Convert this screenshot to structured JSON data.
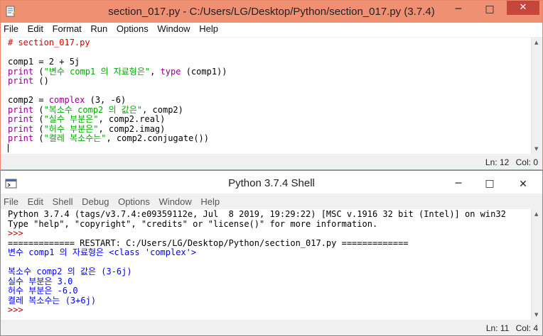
{
  "editor": {
    "title": "section_017.py - C:/Users/LG/Desktop/Python/section_017.py (3.7.4)",
    "menu": [
      "File",
      "Edit",
      "Format",
      "Run",
      "Options",
      "Window",
      "Help"
    ],
    "status": {
      "ln": "Ln: 12",
      "col": "Col: 0"
    },
    "code": [
      [
        [
          "c-comment",
          "# section_017.py"
        ]
      ],
      [],
      [
        [
          "c-normal",
          "comp1 = 2 + 5j"
        ]
      ],
      [
        [
          "c-builtin",
          "print"
        ],
        [
          "c-normal",
          " ("
        ],
        [
          "c-string",
          "\"변수 comp1 의 자료형은\""
        ],
        [
          "c-normal",
          ", "
        ],
        [
          "c-builtin",
          "type"
        ],
        [
          "c-normal",
          " (comp1))"
        ]
      ],
      [
        [
          "c-builtin",
          "print"
        ],
        [
          "c-normal",
          " ()"
        ]
      ],
      [],
      [
        [
          "c-normal",
          "comp2 = "
        ],
        [
          "c-builtin",
          "complex"
        ],
        [
          "c-normal",
          " (3, -6)"
        ]
      ],
      [
        [
          "c-builtin",
          "print"
        ],
        [
          "c-normal",
          " ("
        ],
        [
          "c-string",
          "\"복소수 comp2 의 값은\""
        ],
        [
          "c-normal",
          ", comp2)"
        ]
      ],
      [
        [
          "c-builtin",
          "print"
        ],
        [
          "c-normal",
          " ("
        ],
        [
          "c-string",
          "\"실수 부분은\""
        ],
        [
          "c-normal",
          ", comp2.real)"
        ]
      ],
      [
        [
          "c-builtin",
          "print"
        ],
        [
          "c-normal",
          " ("
        ],
        [
          "c-string",
          "\"허수 부분은\""
        ],
        [
          "c-normal",
          ", comp2.imag)"
        ]
      ],
      [
        [
          "c-builtin",
          "print"
        ],
        [
          "c-normal",
          " ("
        ],
        [
          "c-string",
          "\"켤레 복소수는\""
        ],
        [
          "c-normal",
          ", comp2.conjugate())"
        ]
      ]
    ]
  },
  "shell": {
    "title": "Python 3.7.4 Shell",
    "menu": [
      "File",
      "Edit",
      "Shell",
      "Debug",
      "Options",
      "Window",
      "Help"
    ],
    "status": {
      "ln": "Ln: 11",
      "col": "Col: 4"
    },
    "lines": [
      [
        [
          "c-normal",
          "Python 3.7.4 (tags/v3.7.4:e09359112e, Jul  8 2019, 19:29:22) [MSC v.1916 32 bit (Intel)] on win32"
        ]
      ],
      [
        [
          "c-normal",
          "Type \"help\", \"copyright\", \"credits\" or \"license()\" for more information."
        ]
      ],
      [
        [
          "c-prompt",
          ">>> "
        ]
      ],
      [
        [
          "c-restart",
          "============= RESTART: C:/Users/LG/Desktop/Python/section_017.py ============="
        ]
      ],
      [
        [
          "c-out",
          "변수 comp1 의 자료형은 <class 'complex'>"
        ]
      ],
      [],
      [
        [
          "c-out",
          "복소수 comp2 의 값은 (3-6j)"
        ]
      ],
      [
        [
          "c-out",
          "실수 부분은 3.0"
        ]
      ],
      [
        [
          "c-out",
          "허수 부분은 -6.0"
        ]
      ],
      [
        [
          "c-out",
          "켤레 복소수는 (3+6j)"
        ]
      ],
      [
        [
          "c-prompt",
          ">>> "
        ]
      ]
    ]
  },
  "icons": {
    "min": "─",
    "max": "□",
    "close": "✕",
    "up": "▲",
    "down": "▼"
  }
}
